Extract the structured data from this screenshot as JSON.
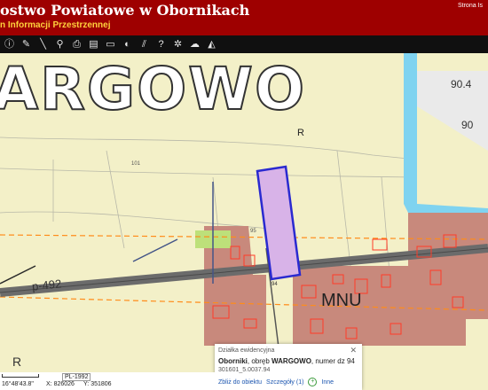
{
  "header": {
    "title": "ostwo Powiatowe w Obornikach",
    "subtitle": "n Informacji Przestrzennej",
    "top_right": "Strona Is"
  },
  "toolbar": {
    "tools": [
      "info-icon",
      "pencil-icon",
      "measure-line-icon",
      "link-icon",
      "print-icon",
      "table-icon",
      "screen-icon",
      "layer-icon",
      "hatch-icon",
      "help-icon",
      "globe-icon",
      "cloud-icon",
      "triangle-icon"
    ]
  },
  "map": {
    "place_name": "ARGOWO",
    "zone_label": "MNU",
    "road_label": "p-492",
    "parcel_label": "R",
    "parcel_number": "95",
    "plot_number": "94",
    "r_label_bottom": "R",
    "contours": [
      "90.4",
      "90",
      "101"
    ],
    "colors": {
      "background": "#f3f0c8",
      "zone_fill": "#c8897c",
      "road": "#6b6b6b",
      "river": "#7fd3f0",
      "plot_outline": "#2a2ad0",
      "plot_fill": "#d8b3e8",
      "parcel_lines": "#ff3c28"
    }
  },
  "popup": {
    "heading": "Działka ewidencyjna",
    "description_prefix": "Oborniki",
    "description_mid": ", obręb ",
    "description_area": "WARGOWO",
    "description_suffix": ", numer dz 94",
    "id": "301601_5.0037.94",
    "link_zoom": "Zbliż do obiektu",
    "link_details": "Szczegóły (1)",
    "link_other": "Inne"
  },
  "statusbar": {
    "crs": "PL-1992",
    "coords": "16°48'43.8\"",
    "x_label": "X:",
    "x_value": "826026",
    "y_label": "Y:",
    "y_value": "351806"
  }
}
